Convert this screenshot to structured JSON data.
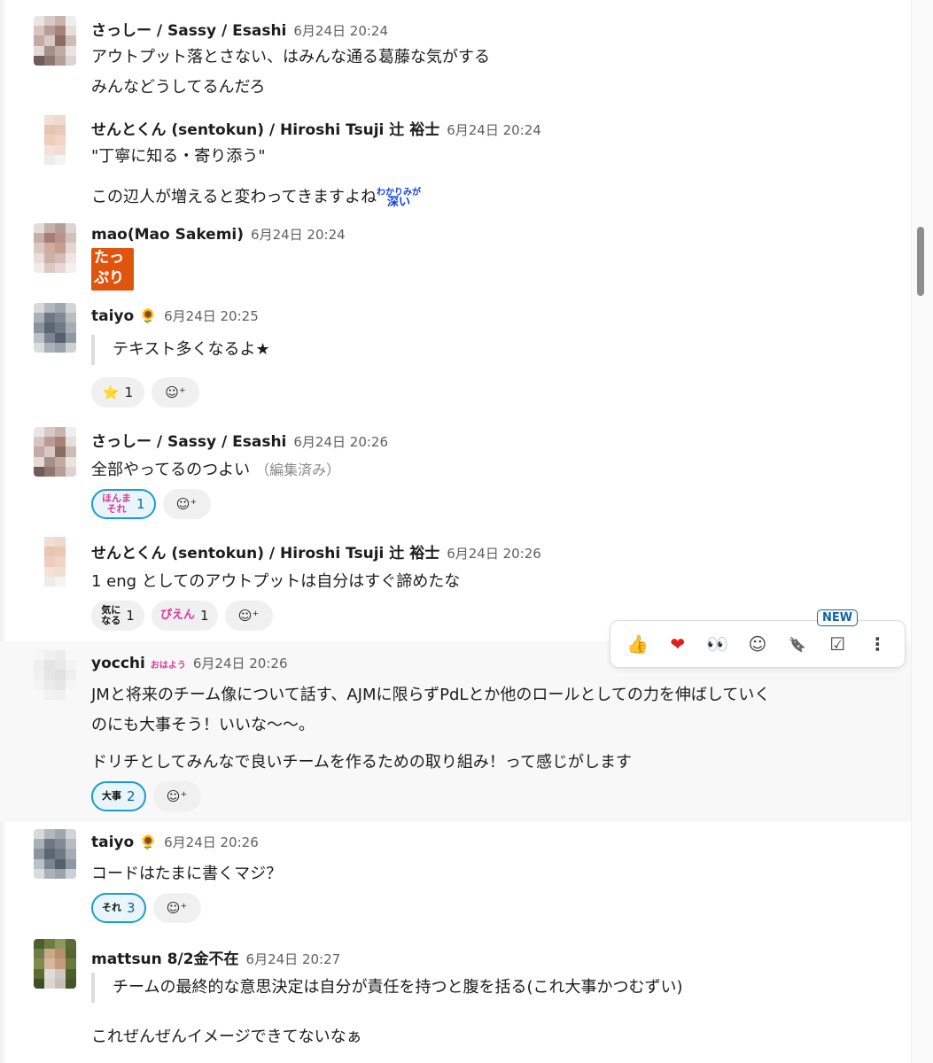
{
  "colors": {
    "accent": "#1264a3",
    "reaction_selected_border": "#1d9bd1",
    "highlight_bg": "#f8f8f8",
    "tappuri_bg": "#e0540d"
  },
  "messages": [
    {
      "author": "さっしー / Sassy / Esashi",
      "time": "6月24日 20:24",
      "lines": [
        "アウトプット落とさない、はみんな通る葛藤な気がする",
        "みんなどうしてるんだろ"
      ]
    },
    {
      "author": "せんとくん (sentokun) / Hiroshi Tsuji 辻 裕士",
      "time": "6月24日 20:24",
      "lines": [
        "\"丁寧に知る・寄り添う\"",
        "この辺人が増えると変わってきますよね"
      ],
      "inline_emoji": [
        "わかりみが",
        "深い"
      ]
    },
    {
      "author": "mao(Mao Sakemi)",
      "time": "6月24日 20:24",
      "emoji_text": [
        "たっ",
        "ぷり"
      ]
    },
    {
      "author": "taiyo",
      "time": "6月24日 20:25",
      "quote": "テキスト多くなるよ★",
      "reactions": [
        {
          "icon": "star-emoji",
          "glyph": "⭐",
          "count": "1"
        }
      ]
    },
    {
      "author": "さっしー / Sassy / Esashi",
      "time": "6月24日 20:26",
      "text": "全部やってるのつよい",
      "edited": "（編集済み）",
      "reactions": [
        {
          "icon": "honmasore-emoji",
          "badge": [
            "ほんま",
            "それ"
          ],
          "count": "1"
        }
      ]
    },
    {
      "author": "せんとくん (sentokun) / Hiroshi Tsuji 辻 裕士",
      "time": "6月24日 20:26",
      "text": "1 eng としてのアウトプットは自分はすぐ諦めたな",
      "reactions": [
        {
          "icon": "kininaru-emoji",
          "badge": [
            "気に",
            "なる"
          ],
          "count": "1"
        },
        {
          "icon": "pien-emoji",
          "badge": [
            "ぴえん"
          ],
          "count": "1"
        }
      ]
    },
    {
      "author": "yocchi",
      "author_badge": "おはよう",
      "time": "6月24日 20:26",
      "lines": [
        "JMと将来のチーム像について話す、AJMに限らずPdLとか他のロールとしての力を伸ばしていく",
        "のにも大事そう！いいな〜〜。",
        "ドリチとしてみんなで良いチームを作るための取り組み！って感じがします"
      ],
      "reactions": [
        {
          "icon": "daiji-emoji",
          "badge": [
            "大事"
          ],
          "count": "2"
        }
      ]
    },
    {
      "author": "taiyo",
      "time": "6月24日 20:26",
      "text": "コードはたまに書くマジ？",
      "reactions": [
        {
          "icon": "sore-emoji",
          "badge": [
            "それ"
          ],
          "count": "3"
        }
      ]
    },
    {
      "author": "mattsun 8/2金不在",
      "time": "6月24日 20:27",
      "quote": "チームの最終的な意思決定は自分が責任を持つと腹を括る(これ大事かつむずい)",
      "text": "これぜんぜんイメージできてないなぁ"
    }
  ],
  "toolbar": {
    "new_label": "NEW",
    "items": [
      {
        "icon": "thumbs-up-icon",
        "glyph": "👍"
      },
      {
        "icon": "heart-icon",
        "glyph": "❤"
      },
      {
        "icon": "eyes-icon",
        "glyph": "👀"
      },
      {
        "icon": "add-reaction-icon",
        "glyph": "☺"
      },
      {
        "icon": "bookmark-icon",
        "glyph": "🔖"
      },
      {
        "icon": "add-to-list-icon",
        "glyph": "☑"
      },
      {
        "icon": "more-icon",
        "glyph": "⋮"
      }
    ]
  }
}
